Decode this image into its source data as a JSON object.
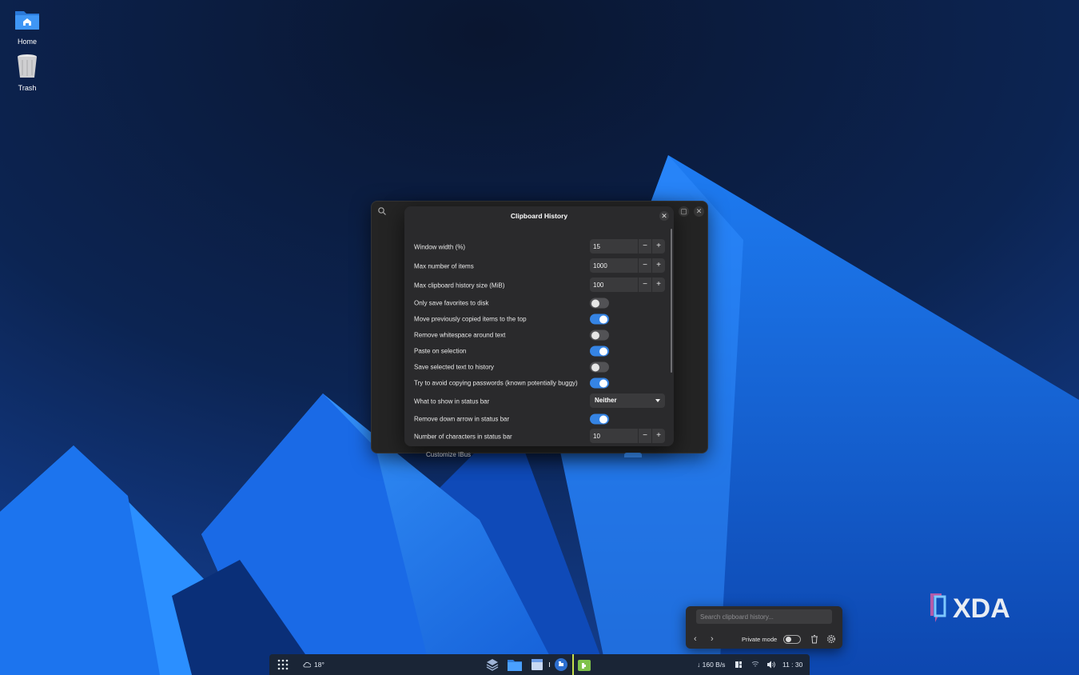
{
  "desktop": {
    "icons": [
      {
        "label": "Home",
        "icon": "folder-home-icon"
      },
      {
        "label": "Trash",
        "icon": "trash-icon"
      }
    ]
  },
  "background_window": {
    "peek_label": "Customize IBus"
  },
  "dialog": {
    "title": "Clipboard History",
    "rows": [
      {
        "label": "Window width (%)",
        "type": "spin",
        "value": "15"
      },
      {
        "label": "Max number of items",
        "type": "spin",
        "value": "1000"
      },
      {
        "label": "Max clipboard history size (MiB)",
        "type": "spin",
        "value": "100"
      },
      {
        "label": "Only save favorites to disk",
        "type": "toggle",
        "on": false
      },
      {
        "label": "Move previously copied items to the top",
        "type": "toggle",
        "on": true
      },
      {
        "label": "Remove whitespace around text",
        "type": "toggle",
        "on": false
      },
      {
        "label": "Paste on selection",
        "type": "toggle",
        "on": true
      },
      {
        "label": "Save selected text to history",
        "type": "toggle",
        "on": false
      },
      {
        "label": "Try to avoid copying passwords (known potentially buggy)",
        "type": "toggle",
        "on": true
      },
      {
        "label": "What to show in status bar",
        "type": "dropdown",
        "value": "Neither"
      },
      {
        "label": "Remove down arrow in status bar",
        "type": "toggle",
        "on": true
      },
      {
        "label": "Number of characters in status bar",
        "type": "spin",
        "value": "10"
      }
    ],
    "minus": "−",
    "plus": "+"
  },
  "clipboard_popup": {
    "search_placeholder": "Search clipboard history...",
    "private_mode_label": "Private mode",
    "private_mode_on": false
  },
  "watermark": "XDA",
  "taskbar": {
    "weather": "18°",
    "network_speed": "↓ 160 B/s",
    "clock": "11 : 30"
  },
  "colors": {
    "accent": "#3584e4",
    "dialog_bg": "#2a2a2c",
    "taskbar_bg": "#1a2536"
  }
}
